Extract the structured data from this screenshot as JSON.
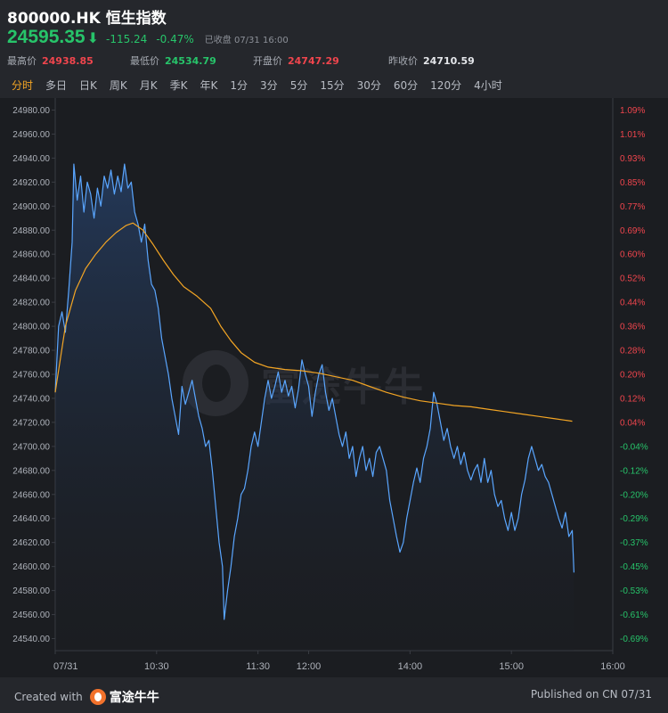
{
  "header": {
    "title": "800000.HK 恒生指数",
    "last_price": "24595.35",
    "change": "-115.24",
    "change_pct": "-0.47%",
    "status": "已收盘 07/31 16:00"
  },
  "stats": [
    {
      "label": "最高价",
      "value": "24938.85",
      "color": "red"
    },
    {
      "label": "最低价",
      "value": "24534.79",
      "color": "green"
    },
    {
      "label": "开盘价",
      "value": "24747.29",
      "color": "red"
    },
    {
      "label": "昨收价",
      "value": "24710.59",
      "color": "gray"
    }
  ],
  "tabs": [
    {
      "label": "分时",
      "active": true
    },
    {
      "label": "多日"
    },
    {
      "label": "日K"
    },
    {
      "label": "周K"
    },
    {
      "label": "月K"
    },
    {
      "label": "季K"
    },
    {
      "label": "年K"
    },
    {
      "label": "1分"
    },
    {
      "label": "3分"
    },
    {
      "label": "5分"
    },
    {
      "label": "15分"
    },
    {
      "label": "30分"
    },
    {
      "label": "60分"
    },
    {
      "label": "120分"
    },
    {
      "label": "4小时"
    }
  ],
  "colors": {
    "up": "#f0454d",
    "down": "#27c46a",
    "price_line": "#5aa6ff",
    "avg_line": "#f3a524",
    "active_tab": "#f3a524"
  },
  "watermark": "富途牛牛",
  "chart_data": {
    "type": "line",
    "title": "",
    "y_ticks": [
      "24980.00",
      "24960.00",
      "24940.00",
      "24920.00",
      "24900.00",
      "24880.00",
      "24860.00",
      "24840.00",
      "24820.00",
      "24800.00",
      "24780.00",
      "24760.00",
      "24740.00",
      "24720.00",
      "24700.00",
      "24680.00",
      "24660.00",
      "24640.00",
      "24620.00",
      "24600.00",
      "24580.00",
      "24560.00",
      "24540.00"
    ],
    "pct_ticks": [
      "1.09%",
      "1.01%",
      "0.93%",
      "0.85%",
      "0.77%",
      "0.69%",
      "0.60%",
      "0.52%",
      "0.44%",
      "0.36%",
      "0.28%",
      "0.20%",
      "0.12%",
      "0.04%",
      "-0.04%",
      "-0.12%",
      "-0.20%",
      "-0.29%",
      "-0.37%",
      "-0.45%",
      "-0.53%",
      "-0.61%",
      "-0.69%"
    ],
    "ylim": [
      24530,
      24990
    ],
    "x_ticks": [
      {
        "label": "07/31",
        "t": 0
      },
      {
        "label": "10:30",
        "t": 60
      },
      {
        "label": "11:30",
        "t": 120
      },
      {
        "label": "12:00",
        "t": 150
      },
      {
        "label": "14:00",
        "t": 210
      },
      {
        "label": "15:00",
        "t": 270
      },
      {
        "label": "16:00",
        "t": 330
      }
    ],
    "x_range": [
      0,
      330
    ],
    "series": [
      {
        "key": "price",
        "points": [
          [
            0,
            24745
          ],
          [
            2,
            24800
          ],
          [
            4,
            24812
          ],
          [
            6,
            24795
          ],
          [
            8,
            24830
          ],
          [
            10,
            24870
          ],
          [
            11,
            24935
          ],
          [
            13,
            24905
          ],
          [
            15,
            24925
          ],
          [
            17,
            24895
          ],
          [
            19,
            24920
          ],
          [
            21,
            24910
          ],
          [
            23,
            24890
          ],
          [
            25,
            24915
          ],
          [
            27,
            24900
          ],
          [
            29,
            24925
          ],
          [
            31,
            24915
          ],
          [
            33,
            24930
          ],
          [
            35,
            24910
          ],
          [
            37,
            24925
          ],
          [
            39,
            24912
          ],
          [
            41,
            24935
          ],
          [
            43,
            24915
          ],
          [
            45,
            24920
          ],
          [
            47,
            24895
          ],
          [
            49,
            24885
          ],
          [
            51,
            24870
          ],
          [
            53,
            24885
          ],
          [
            55,
            24855
          ],
          [
            57,
            24835
          ],
          [
            59,
            24830
          ],
          [
            61,
            24815
          ],
          [
            63,
            24790
          ],
          [
            65,
            24775
          ],
          [
            67,
            24760
          ],
          [
            69,
            24740
          ],
          [
            71,
            24725
          ],
          [
            73,
            24710
          ],
          [
            75,
            24750
          ],
          [
            77,
            24735
          ],
          [
            79,
            24745
          ],
          [
            81,
            24755
          ],
          [
            83,
            24740
          ],
          [
            85,
            24725
          ],
          [
            87,
            24715
          ],
          [
            89,
            24700
          ],
          [
            91,
            24705
          ],
          [
            93,
            24680
          ],
          [
            95,
            24650
          ],
          [
            97,
            24620
          ],
          [
            99,
            24600
          ],
          [
            100,
            24556
          ],
          [
            102,
            24580
          ],
          [
            104,
            24600
          ],
          [
            106,
            24625
          ],
          [
            108,
            24640
          ],
          [
            110,
            24660
          ],
          [
            112,
            24665
          ],
          [
            114,
            24680
          ],
          [
            116,
            24700
          ],
          [
            118,
            24712
          ],
          [
            120,
            24700
          ],
          [
            122,
            24720
          ],
          [
            124,
            24740
          ],
          [
            126,
            24755
          ],
          [
            128,
            24740
          ],
          [
            130,
            24750
          ],
          [
            132,
            24762
          ],
          [
            134,
            24745
          ],
          [
            136,
            24755
          ],
          [
            138,
            24742
          ],
          [
            140,
            24750
          ],
          [
            142,
            24732
          ],
          [
            144,
            24748
          ],
          [
            146,
            24772
          ],
          [
            148,
            24760
          ],
          [
            150,
            24750
          ],
          [
            152,
            24725
          ],
          [
            154,
            24745
          ],
          [
            156,
            24760
          ],
          [
            158,
            24768
          ],
          [
            160,
            24745
          ],
          [
            162,
            24730
          ],
          [
            164,
            24740
          ],
          [
            166,
            24725
          ],
          [
            168,
            24710
          ],
          [
            170,
            24700
          ],
          [
            172,
            24712
          ],
          [
            174,
            24690
          ],
          [
            176,
            24700
          ],
          [
            178,
            24675
          ],
          [
            180,
            24690
          ],
          [
            182,
            24700
          ],
          [
            184,
            24680
          ],
          [
            186,
            24690
          ],
          [
            188,
            24675
          ],
          [
            190,
            24695
          ],
          [
            192,
            24700
          ],
          [
            194,
            24690
          ],
          [
            196,
            24680
          ],
          [
            198,
            24655
          ],
          [
            200,
            24640
          ],
          [
            202,
            24625
          ],
          [
            204,
            24612
          ],
          [
            206,
            24620
          ],
          [
            208,
            24640
          ],
          [
            210,
            24655
          ],
          [
            212,
            24670
          ],
          [
            214,
            24682
          ],
          [
            216,
            24670
          ],
          [
            218,
            24690
          ],
          [
            220,
            24700
          ],
          [
            222,
            24715
          ],
          [
            224,
            24745
          ],
          [
            226,
            24735
          ],
          [
            228,
            24720
          ],
          [
            230,
            24705
          ],
          [
            232,
            24715
          ],
          [
            234,
            24700
          ],
          [
            236,
            24690
          ],
          [
            238,
            24700
          ],
          [
            240,
            24685
          ],
          [
            242,
            24695
          ],
          [
            244,
            24680
          ],
          [
            246,
            24672
          ],
          [
            248,
            24680
          ],
          [
            250,
            24685
          ],
          [
            252,
            24670
          ],
          [
            254,
            24690
          ],
          [
            256,
            24670
          ],
          [
            258,
            24680
          ],
          [
            260,
            24660
          ],
          [
            262,
            24650
          ],
          [
            264,
            24655
          ],
          [
            266,
            24640
          ],
          [
            268,
            24630
          ],
          [
            270,
            24645
          ],
          [
            272,
            24630
          ],
          [
            274,
            24640
          ],
          [
            276,
            24660
          ],
          [
            278,
            24672
          ],
          [
            280,
            24690
          ],
          [
            282,
            24700
          ],
          [
            284,
            24690
          ],
          [
            286,
            24680
          ],
          [
            288,
            24685
          ],
          [
            290,
            24675
          ],
          [
            292,
            24670
          ],
          [
            294,
            24660
          ],
          [
            296,
            24650
          ],
          [
            298,
            24640
          ],
          [
            300,
            24632
          ],
          [
            302,
            24645
          ],
          [
            304,
            24625
          ],
          [
            306,
            24630
          ],
          [
            307,
            24595
          ]
        ]
      },
      {
        "key": "average",
        "points": [
          [
            0,
            24745
          ],
          [
            6,
            24800
          ],
          [
            12,
            24830
          ],
          [
            18,
            24848
          ],
          [
            24,
            24860
          ],
          [
            30,
            24870
          ],
          [
            36,
            24878
          ],
          [
            42,
            24884
          ],
          [
            46,
            24886
          ],
          [
            52,
            24880
          ],
          [
            58,
            24868
          ],
          [
            64,
            24855
          ],
          [
            70,
            24843
          ],
          [
            76,
            24833
          ],
          [
            84,
            24825
          ],
          [
            92,
            24815
          ],
          [
            98,
            24800
          ],
          [
            104,
            24788
          ],
          [
            110,
            24778
          ],
          [
            118,
            24770
          ],
          [
            126,
            24766
          ],
          [
            136,
            24764
          ],
          [
            146,
            24763
          ],
          [
            156,
            24761
          ],
          [
            166,
            24758
          ],
          [
            176,
            24755
          ],
          [
            186,
            24750
          ],
          [
            196,
            24745
          ],
          [
            206,
            24741
          ],
          [
            216,
            24738
          ],
          [
            226,
            24736
          ],
          [
            236,
            24734
          ],
          [
            246,
            24733
          ],
          [
            256,
            24731
          ],
          [
            266,
            24729
          ],
          [
            276,
            24727
          ],
          [
            286,
            24725
          ],
          [
            296,
            24723
          ],
          [
            306,
            24721
          ]
        ]
      }
    ]
  }
}
